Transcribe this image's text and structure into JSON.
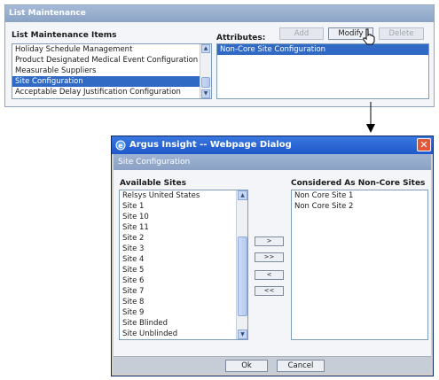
{
  "list_maintenance": {
    "title": "List Maintenance",
    "items_label": "List Maintenance Items",
    "items": [
      {
        "label": "Holiday Schedule Management",
        "selected": false
      },
      {
        "label": "Product Designated Medical Event Configuration",
        "selected": false
      },
      {
        "label": "Measurable Suppliers",
        "selected": false
      },
      {
        "label": "Site Configuration",
        "selected": true
      },
      {
        "label": "Acceptable Delay Justification Configuration",
        "selected": false
      }
    ],
    "attributes_label": "Attributes:",
    "add_label": "Add",
    "modify_label": "Modify",
    "delete_label": "Delete",
    "attributes": [
      {
        "label": "Non-Core Site Configuration",
        "selected": true
      }
    ]
  },
  "dialog": {
    "title": "Argus Insight -- Webpage Dialog",
    "close_symbol": "✕",
    "subtitle": "Site Configuration",
    "available_label": "Available Sites",
    "available_sites": [
      "Relsys United States",
      "Site 1",
      "Site 10",
      "Site 11",
      "Site 2",
      "Site 3",
      "Site 4",
      "Site 5",
      "Site 6",
      "Site 7",
      "Site 8",
      "Site 9",
      "Site Blinded",
      "Site Unblinded"
    ],
    "noncore_label": "Considered As Non-Core Sites",
    "noncore_sites": [
      "Non Core Site 1",
      "Non Core Site 2"
    ],
    "move_buttons": {
      "add_one": ">",
      "add_all": ">>",
      "remove_one": "<",
      "remove_all": "<<"
    },
    "ok_label": "Ok",
    "cancel_label": "Cancel"
  },
  "colors": {
    "panel_header": "#8aa3c6",
    "selection": "#316ac5",
    "titlebar": "#1f57c9",
    "close_button": "#e0573a"
  },
  "icons": [
    "hand-cursor-icon",
    "ie-icon",
    "close-icon",
    "scroll-up-icon",
    "scroll-down-icon"
  ]
}
